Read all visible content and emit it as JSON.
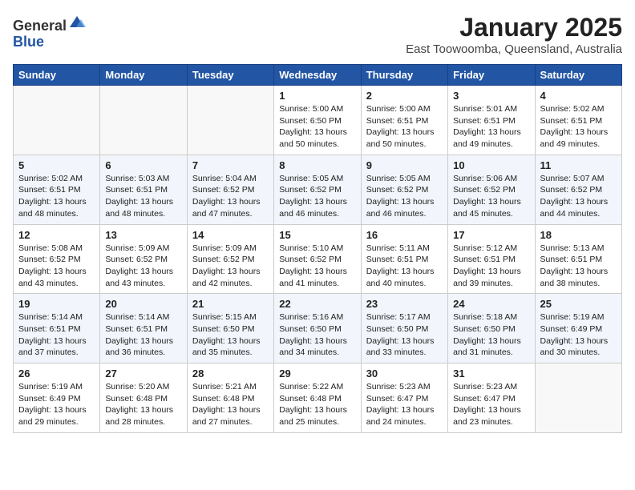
{
  "header": {
    "logo_general": "General",
    "logo_blue": "Blue",
    "title": "January 2025",
    "subtitle": "East Toowoomba, Queensland, Australia"
  },
  "weekdays": [
    "Sunday",
    "Monday",
    "Tuesday",
    "Wednesday",
    "Thursday",
    "Friday",
    "Saturday"
  ],
  "weeks": [
    [
      {
        "day": "",
        "info": ""
      },
      {
        "day": "",
        "info": ""
      },
      {
        "day": "",
        "info": ""
      },
      {
        "day": "1",
        "info": "Sunrise: 5:00 AM\nSunset: 6:50 PM\nDaylight: 13 hours and 50 minutes."
      },
      {
        "day": "2",
        "info": "Sunrise: 5:00 AM\nSunset: 6:51 PM\nDaylight: 13 hours and 50 minutes."
      },
      {
        "day": "3",
        "info": "Sunrise: 5:01 AM\nSunset: 6:51 PM\nDaylight: 13 hours and 49 minutes."
      },
      {
        "day": "4",
        "info": "Sunrise: 5:02 AM\nSunset: 6:51 PM\nDaylight: 13 hours and 49 minutes."
      }
    ],
    [
      {
        "day": "5",
        "info": "Sunrise: 5:02 AM\nSunset: 6:51 PM\nDaylight: 13 hours and 48 minutes."
      },
      {
        "day": "6",
        "info": "Sunrise: 5:03 AM\nSunset: 6:51 PM\nDaylight: 13 hours and 48 minutes."
      },
      {
        "day": "7",
        "info": "Sunrise: 5:04 AM\nSunset: 6:52 PM\nDaylight: 13 hours and 47 minutes."
      },
      {
        "day": "8",
        "info": "Sunrise: 5:05 AM\nSunset: 6:52 PM\nDaylight: 13 hours and 46 minutes."
      },
      {
        "day": "9",
        "info": "Sunrise: 5:05 AM\nSunset: 6:52 PM\nDaylight: 13 hours and 46 minutes."
      },
      {
        "day": "10",
        "info": "Sunrise: 5:06 AM\nSunset: 6:52 PM\nDaylight: 13 hours and 45 minutes."
      },
      {
        "day": "11",
        "info": "Sunrise: 5:07 AM\nSunset: 6:52 PM\nDaylight: 13 hours and 44 minutes."
      }
    ],
    [
      {
        "day": "12",
        "info": "Sunrise: 5:08 AM\nSunset: 6:52 PM\nDaylight: 13 hours and 43 minutes."
      },
      {
        "day": "13",
        "info": "Sunrise: 5:09 AM\nSunset: 6:52 PM\nDaylight: 13 hours and 43 minutes."
      },
      {
        "day": "14",
        "info": "Sunrise: 5:09 AM\nSunset: 6:52 PM\nDaylight: 13 hours and 42 minutes."
      },
      {
        "day": "15",
        "info": "Sunrise: 5:10 AM\nSunset: 6:52 PM\nDaylight: 13 hours and 41 minutes."
      },
      {
        "day": "16",
        "info": "Sunrise: 5:11 AM\nSunset: 6:51 PM\nDaylight: 13 hours and 40 minutes."
      },
      {
        "day": "17",
        "info": "Sunrise: 5:12 AM\nSunset: 6:51 PM\nDaylight: 13 hours and 39 minutes."
      },
      {
        "day": "18",
        "info": "Sunrise: 5:13 AM\nSunset: 6:51 PM\nDaylight: 13 hours and 38 minutes."
      }
    ],
    [
      {
        "day": "19",
        "info": "Sunrise: 5:14 AM\nSunset: 6:51 PM\nDaylight: 13 hours and 37 minutes."
      },
      {
        "day": "20",
        "info": "Sunrise: 5:14 AM\nSunset: 6:51 PM\nDaylight: 13 hours and 36 minutes."
      },
      {
        "day": "21",
        "info": "Sunrise: 5:15 AM\nSunset: 6:50 PM\nDaylight: 13 hours and 35 minutes."
      },
      {
        "day": "22",
        "info": "Sunrise: 5:16 AM\nSunset: 6:50 PM\nDaylight: 13 hours and 34 minutes."
      },
      {
        "day": "23",
        "info": "Sunrise: 5:17 AM\nSunset: 6:50 PM\nDaylight: 13 hours and 33 minutes."
      },
      {
        "day": "24",
        "info": "Sunrise: 5:18 AM\nSunset: 6:50 PM\nDaylight: 13 hours and 31 minutes."
      },
      {
        "day": "25",
        "info": "Sunrise: 5:19 AM\nSunset: 6:49 PM\nDaylight: 13 hours and 30 minutes."
      }
    ],
    [
      {
        "day": "26",
        "info": "Sunrise: 5:19 AM\nSunset: 6:49 PM\nDaylight: 13 hours and 29 minutes."
      },
      {
        "day": "27",
        "info": "Sunrise: 5:20 AM\nSunset: 6:48 PM\nDaylight: 13 hours and 28 minutes."
      },
      {
        "day": "28",
        "info": "Sunrise: 5:21 AM\nSunset: 6:48 PM\nDaylight: 13 hours and 27 minutes."
      },
      {
        "day": "29",
        "info": "Sunrise: 5:22 AM\nSunset: 6:48 PM\nDaylight: 13 hours and 25 minutes."
      },
      {
        "day": "30",
        "info": "Sunrise: 5:23 AM\nSunset: 6:47 PM\nDaylight: 13 hours and 24 minutes."
      },
      {
        "day": "31",
        "info": "Sunrise: 5:23 AM\nSunset: 6:47 PM\nDaylight: 13 hours and 23 minutes."
      },
      {
        "day": "",
        "info": ""
      }
    ]
  ]
}
